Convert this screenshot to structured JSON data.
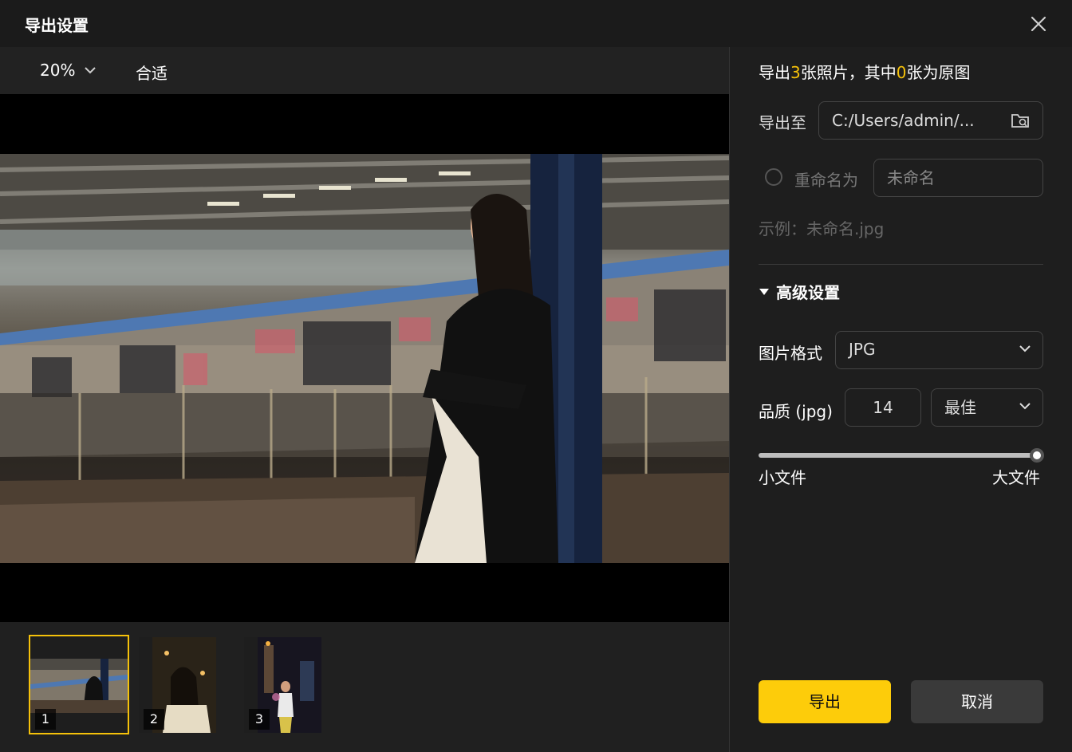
{
  "dialog": {
    "title": "导出设置"
  },
  "toolbar": {
    "zoom_value": "20%",
    "fit_label": "合适"
  },
  "thumbnails": [
    {
      "number": "1",
      "selected": true
    },
    {
      "number": "2",
      "selected": false
    },
    {
      "number": "3",
      "selected": false
    }
  ],
  "summary": {
    "prefix": "导出",
    "photo_count": "3",
    "middle": "张照片，其中",
    "original_count": "0",
    "suffix": "张为原图"
  },
  "export_to": {
    "label": "导出至",
    "path": "C:/Users/admin/..."
  },
  "rename": {
    "label": "重命名为",
    "value": "未命名",
    "checked": false
  },
  "example_text": "示例：未命名.jpg",
  "advanced": {
    "label": "高级设置",
    "expanded": true
  },
  "format": {
    "label": "图片格式",
    "value": "JPG"
  },
  "quality": {
    "label": "品质 (jpg)",
    "number": "14",
    "preset": "最佳",
    "slider_fraction": 1.0
  },
  "slider_labels": {
    "min": "小文件",
    "max": "大文件"
  },
  "buttons": {
    "export": "导出",
    "cancel": "取消"
  },
  "colors": {
    "accent": "#fdcc0a",
    "highlight_text": "#f5c10a",
    "background": "#1e1e1e"
  }
}
